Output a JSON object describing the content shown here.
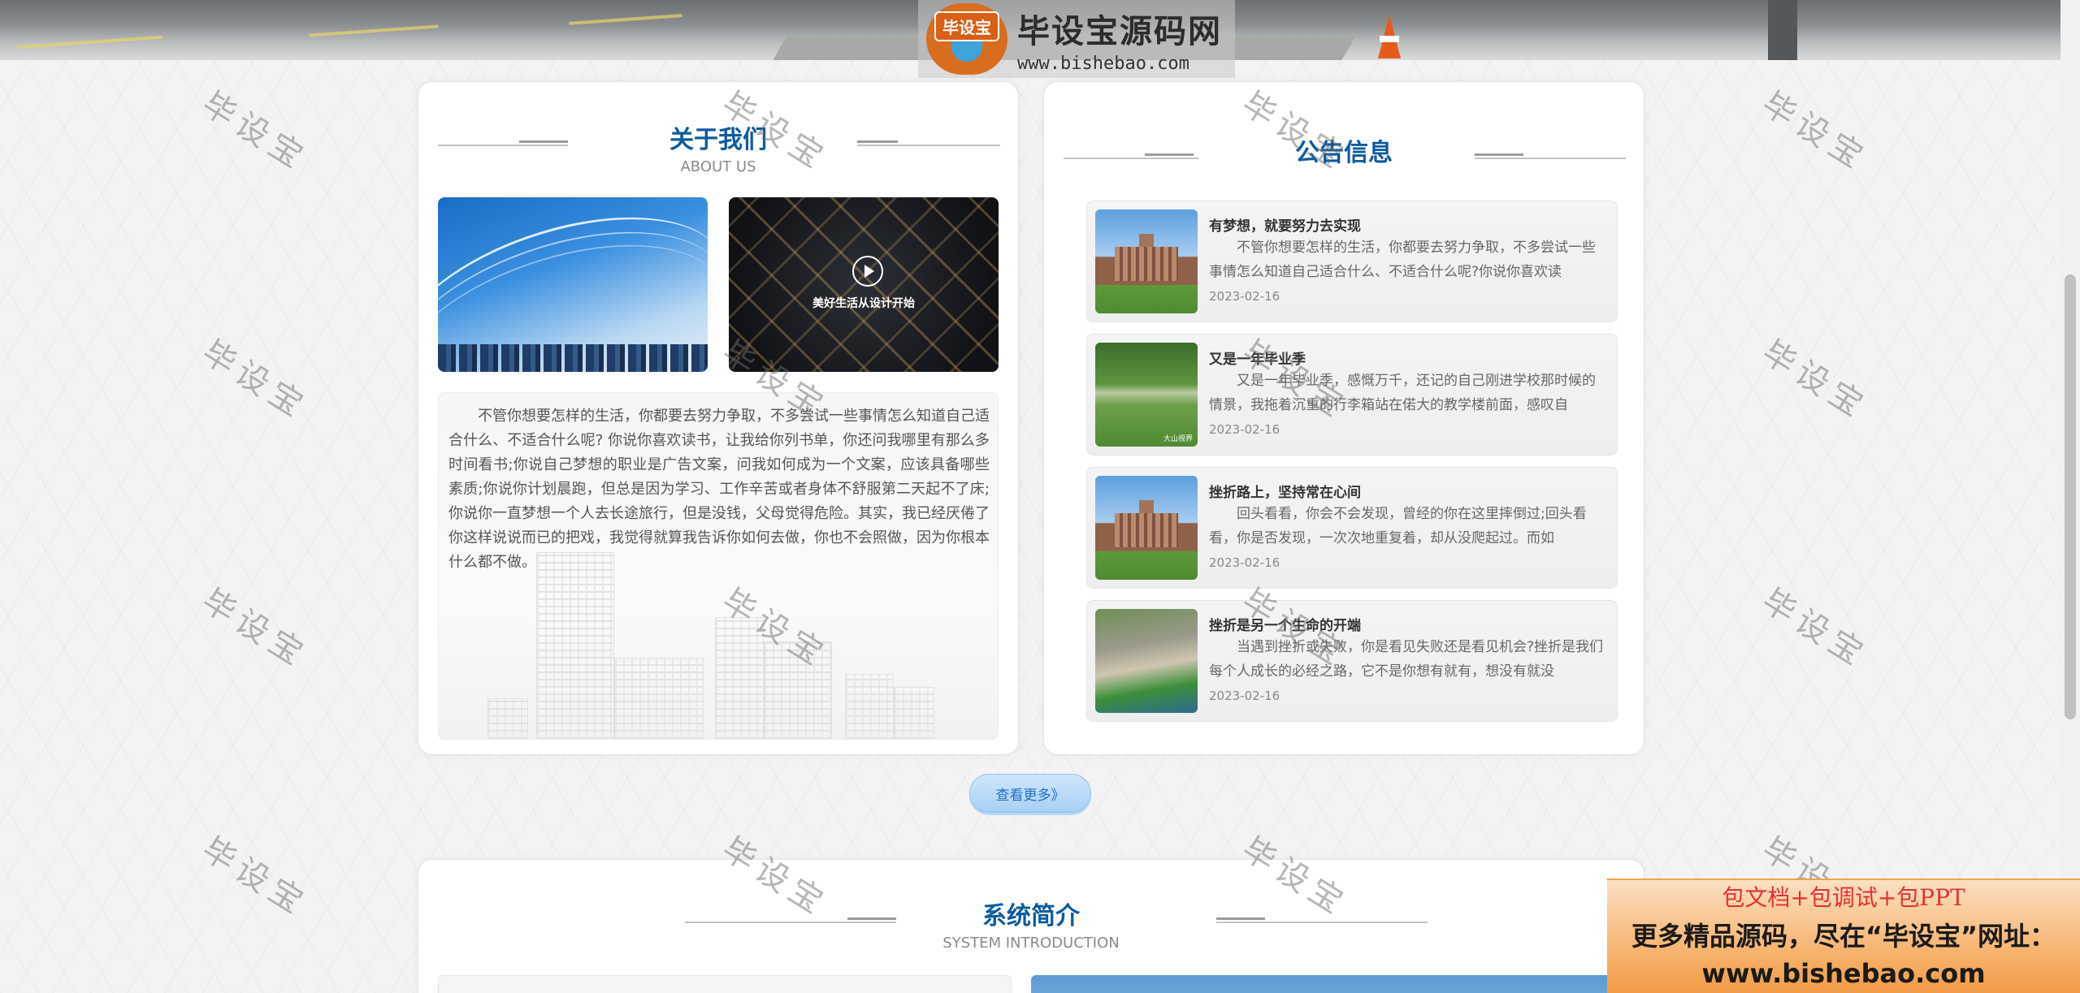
{
  "logo": {
    "badge": "毕设宝",
    "title": "毕设宝源码网",
    "url": "www.bishebao.com"
  },
  "about": {
    "title": "关于我们",
    "subtitle": "ABOUT US",
    "image_caption": "美好生活从设计开始",
    "text": "不管你想要怎样的生活，你都要去努力争取，不多尝试一些事情怎么知道自己适合什么、不适合什么呢? 你说你喜欢读书，让我给你列书单，你还问我哪里有那么多时间看书;你说自己梦想的职业是广告文案，问我如何成为一个文案，应该具备哪些素质;你说你计划晨跑，但总是因为学习、工作辛苦或者身体不舒服第二天起不了床;你说你一直梦想一个人去长途旅行，但是没钱，父母觉得危险。其实，我已经厌倦了你这样说说而已的把戏，我觉得就算我告诉你如何去做，你也不会照做，因为你根本什么都不做。"
  },
  "notice": {
    "title": "公告信息",
    "items": [
      {
        "title": "有梦想，就要努力去实现",
        "desc": "不管你想要怎样的生活，你都要去努力争取，不多尝试一些事情怎么知道自己适合什么、不适合什么呢?你说你喜欢读",
        "date": "2023-02-16"
      },
      {
        "title": "又是一年毕业季",
        "desc": "又是一年毕业季，感慨万千，还记的自己刚进学校那时候的情景，我拖着沉重的行李箱站在偌大的教学楼前面，感叹自",
        "date": "2023-02-16",
        "thumb_label": "大山视界"
      },
      {
        "title": "挫折路上，坚持常在心间",
        "desc": "回头看看，你会不会发现，曾经的你在这里摔倒过;回头看看，你是否发现，一次次地重复着，却从没爬起过。而如",
        "date": "2023-02-16"
      },
      {
        "title": "挫折是另一个生命的开端",
        "desc": "当遇到挫折或失败，你是看见失败还是看见机会?挫折是我们每个人成长的必经之路，它不是你想有就有，想没有就没",
        "date": "2023-02-16"
      }
    ]
  },
  "more_button": "查看更多》",
  "system": {
    "title": "系统简介",
    "subtitle": "SYSTEM INTRODUCTION"
  },
  "watermark": "毕设宝",
  "promo": {
    "line1": "包文档+包调试+包PPT",
    "line2": "更多精品源码，尽在“毕设宝”网址：",
    "line3": "www.bishebao.com"
  }
}
